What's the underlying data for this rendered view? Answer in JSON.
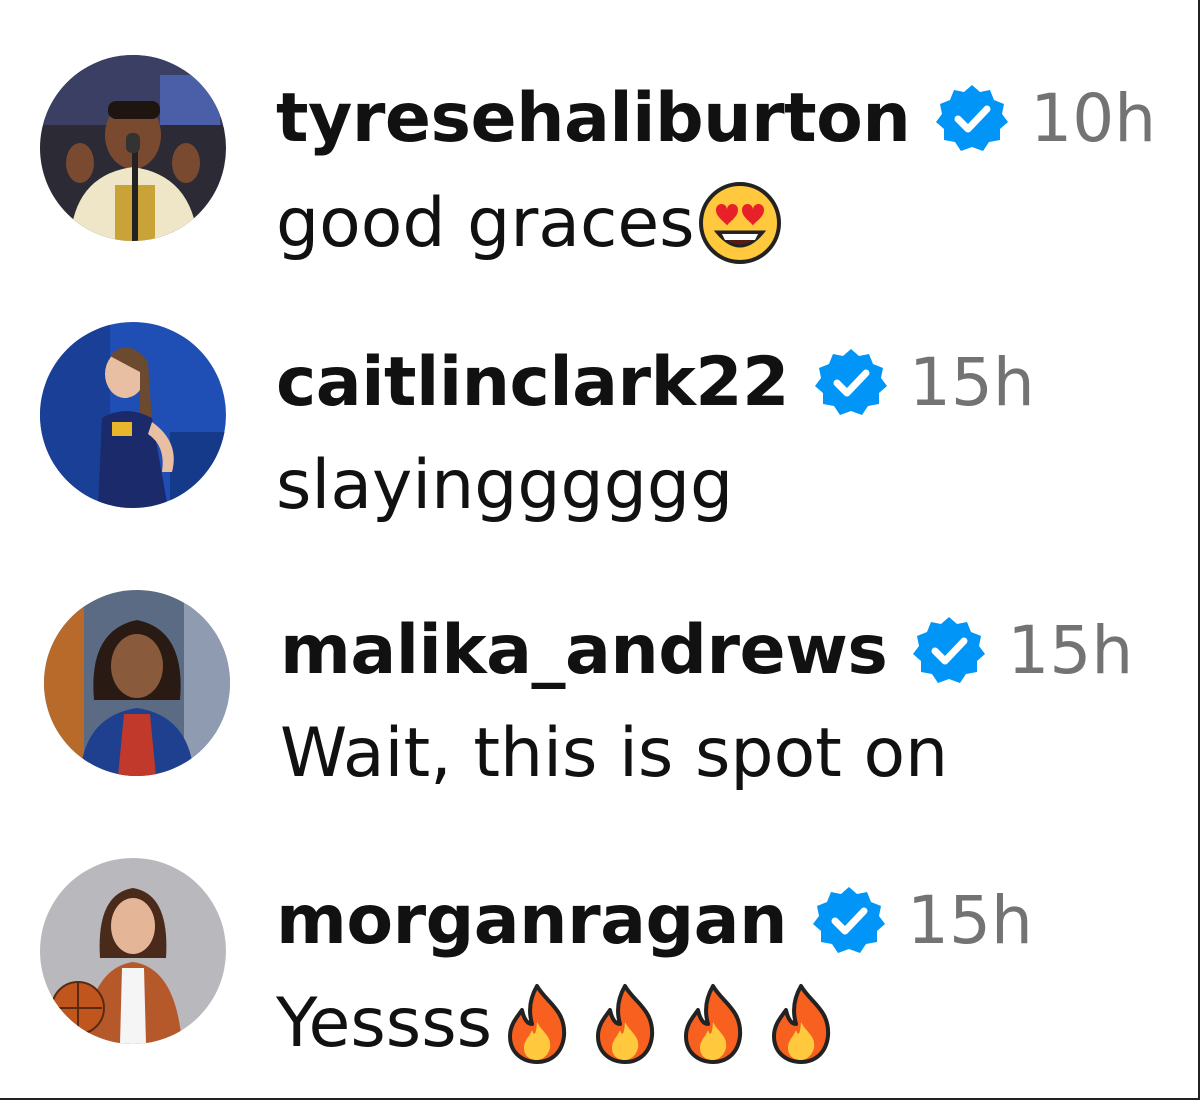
{
  "comments": [
    {
      "username": "tyresehaliburton",
      "time": "10h",
      "text": "good graces",
      "emoji": "heart-eyes-emoji",
      "emoji_count": 1,
      "verified": true
    },
    {
      "username": "caitlinclark22",
      "time": "15h",
      "text": "slayingggggg",
      "verified": true
    },
    {
      "username": "malika_andrews",
      "time": "15h",
      "text": "Wait, this is spot on",
      "verified": true
    },
    {
      "username": "morganragan",
      "time": "15h",
      "text": "Yessss",
      "emoji": "fire-emoji",
      "emoji_count": 4,
      "verified": true
    }
  ],
  "colors": {
    "verified_blue": "#0095f6",
    "time_gray": "#737373",
    "text": "#111111"
  }
}
